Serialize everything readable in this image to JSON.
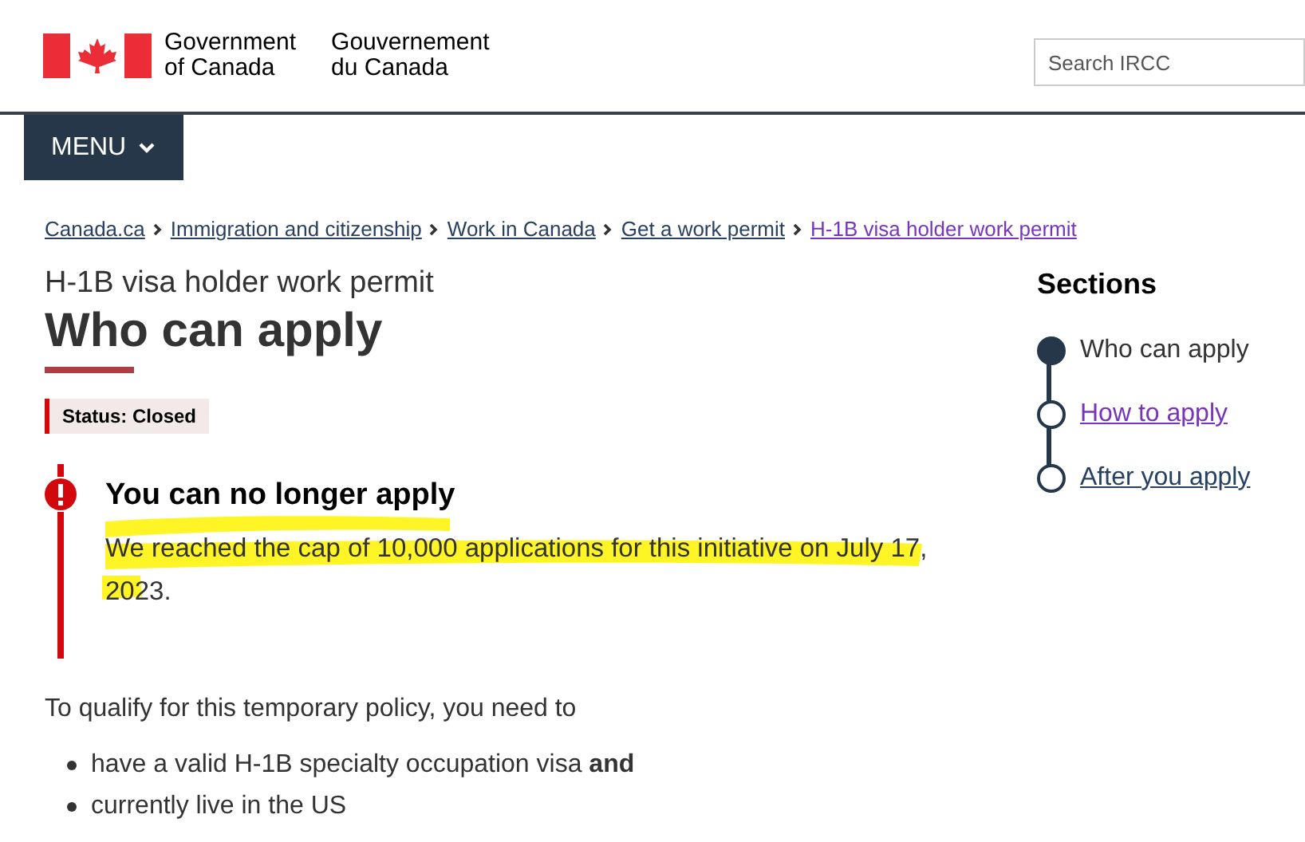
{
  "header": {
    "name_en": [
      "Government",
      "of Canada"
    ],
    "name_fr": [
      "Gouvernement",
      "du Canada"
    ],
    "search": {
      "placeholder": "Search IRCC"
    }
  },
  "menu": {
    "label": "MENU",
    "expanded": false
  },
  "breadcrumbs": [
    {
      "label": "Canada.ca",
      "visited": false
    },
    {
      "label": "Immigration and citizenship",
      "visited": false
    },
    {
      "label": "Work in Canada",
      "visited": false
    },
    {
      "label": "Get a work permit",
      "visited": false
    },
    {
      "label": "H-1B visa holder work permit",
      "visited": true
    }
  ],
  "page": {
    "subtitle": "H-1B visa holder work permit",
    "title": "Who can apply",
    "status": "Status: Closed"
  },
  "alert": {
    "kind": "danger",
    "heading": "You can no longer apply",
    "text": "We reached the cap of 10,000 applications for this initiative on July 17, 2023.",
    "highlighted": true
  },
  "intro": "To qualify for this temporary policy, you need to",
  "requirements": [
    "have a valid H-1B specialty occupation visa **and**",
    "currently live in the US"
  ],
  "sections": {
    "title": "Sections",
    "items": [
      {
        "label": "Who can apply",
        "selected": true
      },
      {
        "label": "How to apply",
        "selected": false,
        "visited": true
      },
      {
        "label": "After you apply",
        "selected": false,
        "visited": false
      }
    ]
  }
}
